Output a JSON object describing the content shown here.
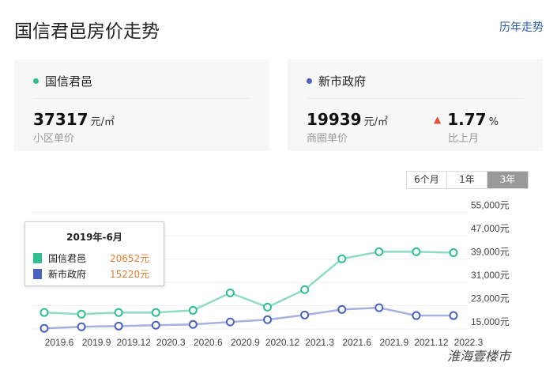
{
  "header": {
    "title": "国信君邑房价走势",
    "history_link": "历年走势"
  },
  "cards": [
    {
      "name": "国信君邑",
      "color": "#2ec08e",
      "price": "37317",
      "unit": "元/㎡",
      "sub": "小区单价"
    },
    {
      "name": "新市政府",
      "color": "#4a62c0",
      "price": "19939",
      "unit": "元/㎡",
      "sub": "商圈单价",
      "change": "1.77",
      "change_unit": "%",
      "change_sub": "比上月",
      "change_dir": "up"
    }
  ],
  "range": {
    "options": [
      "6个月",
      "1年",
      "3年"
    ],
    "active": "3年"
  },
  "tooltip": {
    "title": "2019年-6月",
    "rows": [
      {
        "name": "国信君邑",
        "value": "20652元",
        "color": "#2ec08e"
      },
      {
        "name": "新市政府",
        "value": "15220元",
        "color": "#4a62c0"
      }
    ]
  },
  "watermark": "淮海壹楼市",
  "chart_data": {
    "type": "line",
    "x": [
      "2019.6",
      "2019.9",
      "2019.12",
      "2020.3",
      "2020.6",
      "2020.9",
      "2020.12",
      "2021.3",
      "2021.6",
      "2021.9",
      "2021.12",
      "2022.3"
    ],
    "x_tick_labels": [
      "2019.6",
      "2019.9",
      "2019.12",
      "2020.3",
      "2020.6",
      "2020.9",
      "2020.12",
      "2021.3",
      "2021.6",
      "2021.9",
      "2021.12",
      "2022.3"
    ],
    "y_ticks": [
      15000,
      23000,
      31000,
      39000,
      47000,
      55000
    ],
    "y_tick_labels": [
      "15,000元",
      "23,000元",
      "31,000元",
      "39,000元",
      "47,000元",
      "55,000元"
    ],
    "ylim": [
      15000,
      55000
    ],
    "grid": true,
    "series": [
      {
        "name": "国信君邑",
        "color": "#2ec08e",
        "line_color": "#8fdcbf",
        "values": [
          20652,
          20100,
          20650,
          20650,
          21400,
          27400,
          22500,
          28500,
          39100,
          41500,
          41500,
          41200
        ]
      },
      {
        "name": "新市政府",
        "color": "#4a62c0",
        "line_color": "#a7b1e0",
        "values": [
          15220,
          15750,
          16000,
          16300,
          16550,
          17400,
          18200,
          19800,
          21700,
          22300,
          19600,
          19600
        ]
      }
    ]
  }
}
